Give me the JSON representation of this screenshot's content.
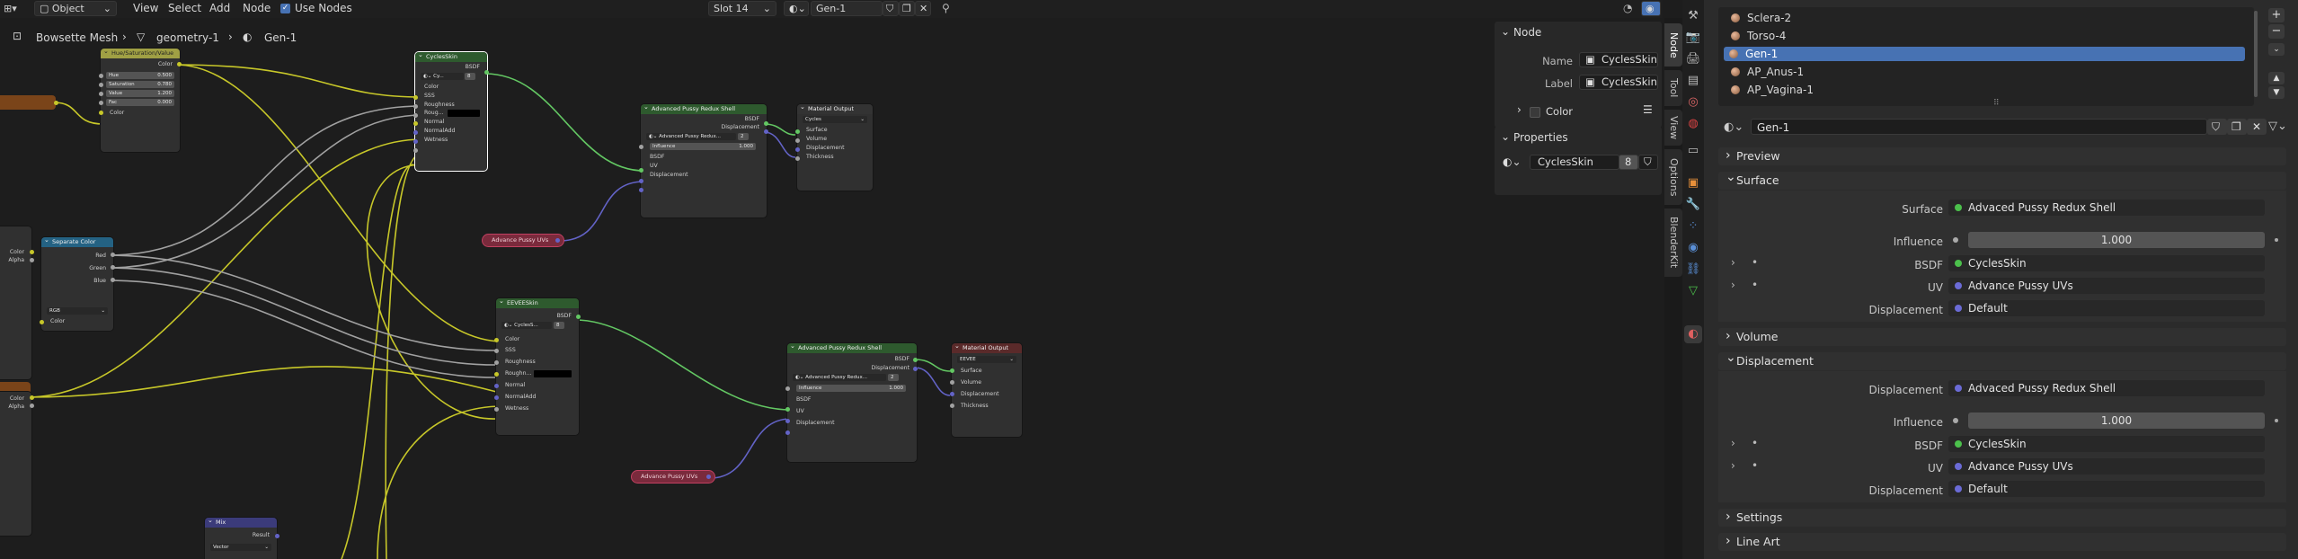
{
  "header": {
    "mode": "Object",
    "menus": [
      "View",
      "Select",
      "Add",
      "Node"
    ],
    "use_nodes_label": "Use Nodes",
    "slot": "Slot 14",
    "material": "Gen-1"
  },
  "breadcrumb": {
    "object": "Bowsette Mesh",
    "mesh": "geometry-1",
    "material": "Gen-1"
  },
  "nodes": {
    "hsv": {
      "title": "Hue/Saturation/Value",
      "out": "Color",
      "hue": "Hue",
      "hue_v": "0.500",
      "sat": "Saturation",
      "sat_v": "0.780",
      "val": "Value",
      "val_v": "1.200",
      "fac": "Fac",
      "fac_v": "0.000",
      "color": "Color"
    },
    "cycles_skin": {
      "title": "CyclesSkin",
      "out": "BSDF",
      "group": "Cy...",
      "users": "8",
      "inputs": [
        "Color",
        "SSS",
        "Roughness",
        "Roug...",
        "Normal",
        "NormalAdd",
        "Wetness"
      ]
    },
    "shell1": {
      "title": "Advanced Pussy Redux Shell",
      "bsdf": "BSDF",
      "disp": "Displacement",
      "group": "Advanced Pussy Redux...",
      "users": "2",
      "influence": "Influence",
      "influence_v": "1.000",
      "in_bsdf": "BSDF",
      "in_uv": "UV",
      "in_disp": "Displacement"
    },
    "out1": {
      "title": "Material Output",
      "target": "Cycles",
      "inputs": [
        "Surface",
        "Volume",
        "Displacement",
        "Thickness"
      ]
    },
    "uv1": {
      "label": "Advance Pussy UVs"
    },
    "sep": {
      "title": "Separate Color",
      "outs": [
        "Red",
        "Green",
        "Blue"
      ],
      "mode": "RGB",
      "color": "Color"
    },
    "left_frag1": {
      "outs": [
        "Color",
        "Alpha"
      ]
    },
    "left_frag2": {
      "outs": [
        "Color",
        "Alpha"
      ]
    },
    "eevee_skin": {
      "title": "EEVEESkin",
      "out": "BSDF",
      "group": "CyclesS...",
      "users": "8",
      "inputs": [
        "Color",
        "SSS",
        "Roughness",
        "Roughn...",
        "Normal",
        "NormalAdd",
        "Wetness"
      ]
    },
    "shell2": {
      "title": "Advanced Pussy Redux Shell",
      "bsdf": "BSDF",
      "disp": "Displacement",
      "group": "Advanced Pussy Redux...",
      "users": "2",
      "influence": "Influence",
      "influence_v": "1.000",
      "in_bsdf": "BSDF",
      "in_uv": "UV",
      "in_disp": "Displacement"
    },
    "out2": {
      "title": "Material Output",
      "target": "EEVEE",
      "inputs": [
        "Surface",
        "Volume",
        "Displacement",
        "Thickness"
      ]
    },
    "uv2": {
      "label": "Advance Pussy UVs"
    },
    "mix": {
      "title": "Mix",
      "result": "Result",
      "type": "Vector"
    }
  },
  "npanel": {
    "node_title": "Node",
    "name_label": "Name",
    "name_value": "CyclesSkin",
    "label_label": "Label",
    "label_value": "CyclesSkin",
    "color_label": "Color",
    "props_title": "Properties",
    "group_value": "CyclesSkin",
    "group_users": "8"
  },
  "vtabs": [
    "Node",
    "Tool",
    "View",
    "Options",
    "BlenderKit"
  ],
  "properties": {
    "materials": [
      "Sclera-2",
      "Torso-4",
      "Gen-1",
      "AP_Anus-1",
      "AP_Vagina-1"
    ],
    "selected_index": 2,
    "active_material": "Gen-1",
    "preview": "Preview",
    "surface_panel": "Surface",
    "surface_label": "Surface",
    "surface_value": "Advaced Pussy Redux Shell",
    "influence_label": "Influence",
    "influence_value": "1.000",
    "bsdf_label": "BSDF",
    "bsdf_value": "CyclesSkin",
    "uv_label": "UV",
    "uv_value": "Advance Pussy UVs",
    "disp_label": "Displacement",
    "disp_value": "Default",
    "volume_panel": "Volume",
    "displacement_panel": "Displacement",
    "d_disp_label": "Displacement",
    "d_disp_value": "Advaced Pussy Redux Shell",
    "d_influence_label": "Influence",
    "d_influence_value": "1.000",
    "d_bsdf_label": "BSDF",
    "d_bsdf_value": "CyclesSkin",
    "d_uv_label": "UV",
    "d_uv_value": "Advance Pussy UVs",
    "d_disp2_label": "Displacement",
    "d_disp2_value": "Default",
    "settings_panel": "Settings",
    "lineart_panel": "Line Art"
  }
}
